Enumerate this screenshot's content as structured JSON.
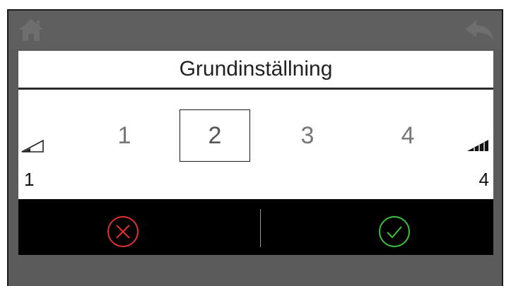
{
  "colors": {
    "frame_bg": "#5b5b5b",
    "cancel": "#e03030",
    "confirm": "#3fbf3f",
    "action_bar": "#000000"
  },
  "topbar": {
    "home_icon": "home-icon",
    "back_icon": "back-arrow-icon"
  },
  "dialog": {
    "title": "Grundinställning",
    "options": [
      "1",
      "2",
      "3",
      "4"
    ],
    "selected_value": "2",
    "range_min": "1",
    "range_max": "4",
    "low_icon": "signal-low-icon",
    "high_icon": "signal-high-icon"
  },
  "actions": {
    "cancel_icon": "cancel-x-icon",
    "confirm_icon": "confirm-check-icon"
  }
}
